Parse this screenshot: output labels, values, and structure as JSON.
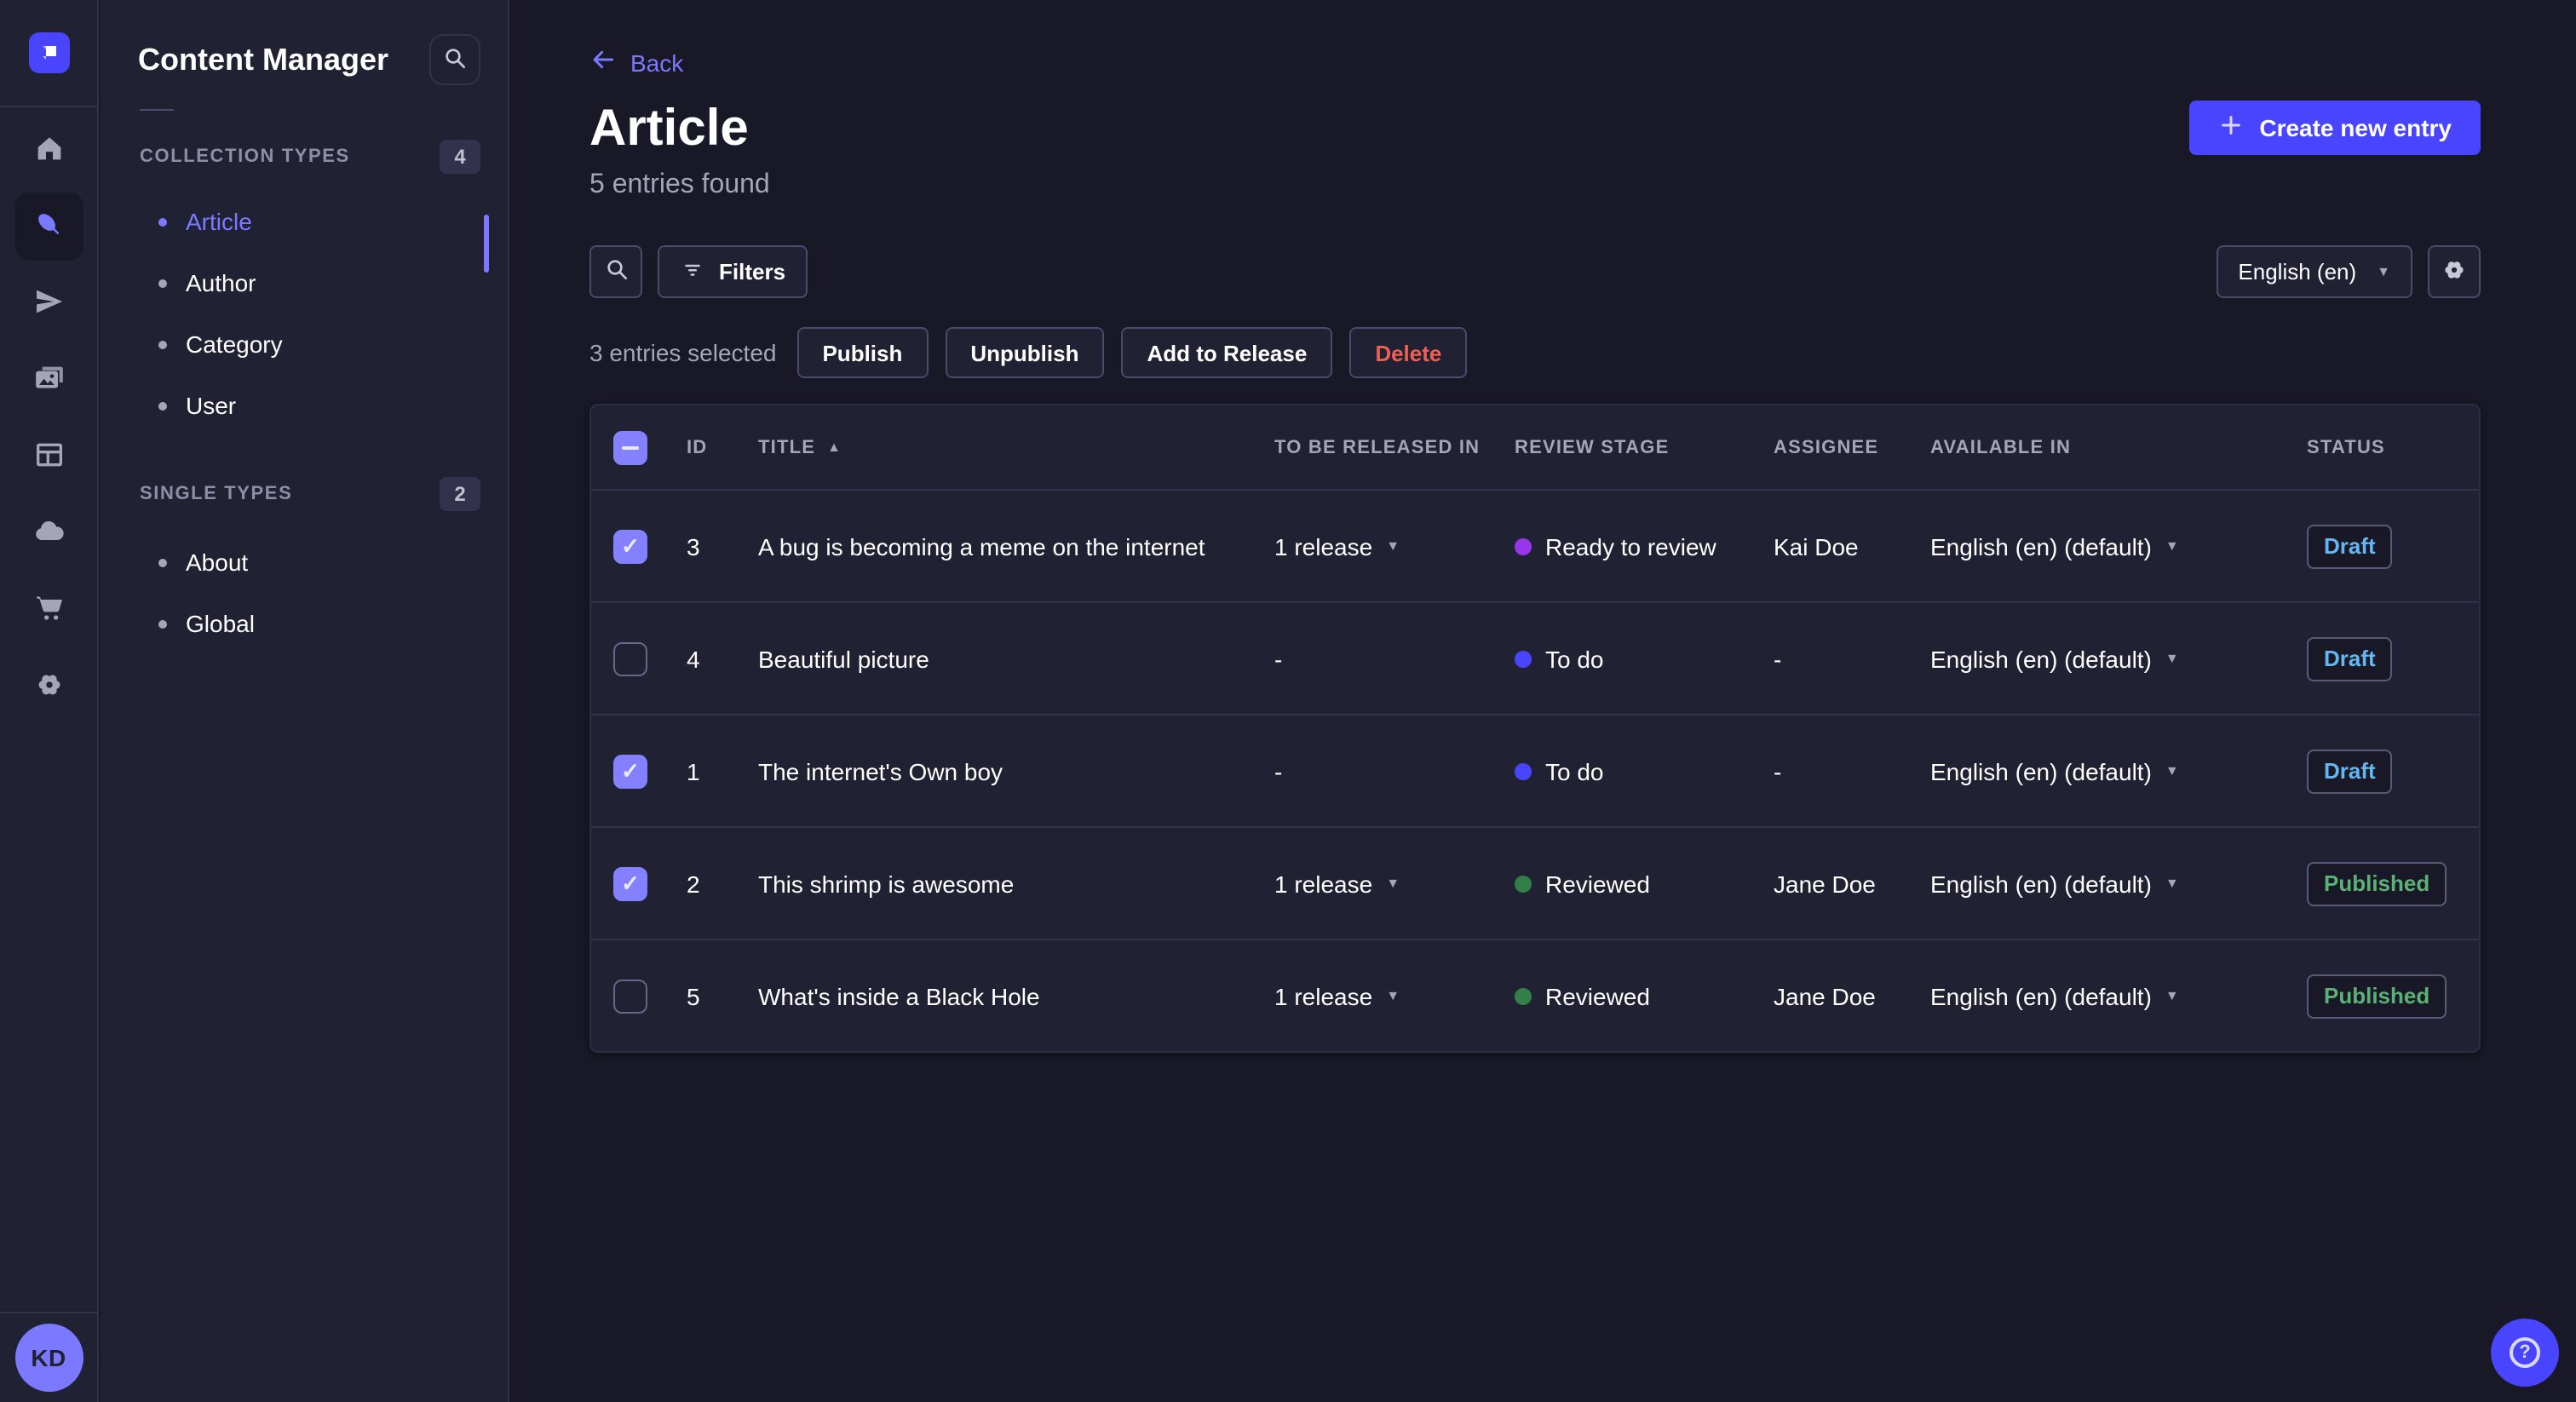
{
  "rail": {
    "icons": [
      "home",
      "content-manager",
      "releases",
      "media-library",
      "content-type-builder",
      "deploy",
      "marketplace",
      "settings"
    ],
    "active_icon": "content-manager",
    "avatar_initials": "KD"
  },
  "subnav": {
    "title": "Content Manager",
    "sections": [
      {
        "label": "COLLECTION TYPES",
        "count": "4",
        "items": [
          {
            "label": "Article",
            "active": true
          },
          {
            "label": "Author",
            "active": false
          },
          {
            "label": "Category",
            "active": false
          },
          {
            "label": "User",
            "active": false
          }
        ]
      },
      {
        "label": "SINGLE TYPES",
        "count": "2",
        "items": [
          {
            "label": "About",
            "active": false
          },
          {
            "label": "Global",
            "active": false
          }
        ]
      }
    ]
  },
  "header": {
    "back_label": "Back",
    "title": "Article",
    "subtitle": "5 entries found",
    "create_button": "Create new entry"
  },
  "toolbar": {
    "filters_label": "Filters",
    "locale_selected": "English (en)"
  },
  "selection": {
    "summary": "3 entries selected",
    "publish_label": "Publish",
    "unpublish_label": "Unpublish",
    "add_to_release_label": "Add to Release",
    "delete_label": "Delete"
  },
  "table": {
    "columns": [
      "ID",
      "TITLE",
      "TO BE RELEASED IN",
      "REVIEW STAGE",
      "ASSIGNEE",
      "AVAILABLE IN",
      "STATUS"
    ],
    "sorted_column": "TITLE",
    "sort_direction": "asc",
    "header_checkbox_state": "indeterminate",
    "rows": [
      {
        "checked": true,
        "id": "3",
        "title": "A bug is becoming a meme on the internet",
        "release": "1 release",
        "has_release_caret": true,
        "stage": "Ready to review",
        "stage_color": "#9736e8",
        "assignee": "Kai Doe",
        "locale": "English (en) (default)",
        "status": "Draft",
        "status_color": "#66b7f1"
      },
      {
        "checked": false,
        "id": "4",
        "title": "Beautiful picture",
        "release": "-",
        "has_release_caret": false,
        "stage": "To do",
        "stage_color": "#4945ff",
        "assignee": "-",
        "locale": "English (en) (default)",
        "status": "Draft",
        "status_color": "#66b7f1"
      },
      {
        "checked": true,
        "id": "1",
        "title": "The internet's Own boy",
        "release": "-",
        "has_release_caret": false,
        "stage": "To do",
        "stage_color": "#4945ff",
        "assignee": "-",
        "locale": "English (en) (default)",
        "status": "Draft",
        "status_color": "#66b7f1"
      },
      {
        "checked": true,
        "id": "2",
        "title": "This shrimp is awesome",
        "release": "1 release",
        "has_release_caret": true,
        "stage": "Reviewed",
        "stage_color": "#328048",
        "assignee": "Jane Doe",
        "locale": "English (en) (default)",
        "status": "Published",
        "status_color": "#5cb176"
      },
      {
        "checked": false,
        "id": "5",
        "title": "What's inside a Black Hole",
        "release": "1 release",
        "has_release_caret": true,
        "stage": "Reviewed",
        "stage_color": "#328048",
        "assignee": "Jane Doe",
        "locale": "English (en) (default)",
        "status": "Published",
        "status_color": "#5cb176"
      }
    ]
  },
  "help": {
    "glyph": "?"
  },
  "colors": {
    "primary": "#4945ff",
    "primary_light": "#7b79ff",
    "danger": "#ee5e52",
    "success": "#5cb176",
    "draft": "#66b7f1",
    "surface": "#212134",
    "background": "#181826",
    "border": "#32324d"
  }
}
